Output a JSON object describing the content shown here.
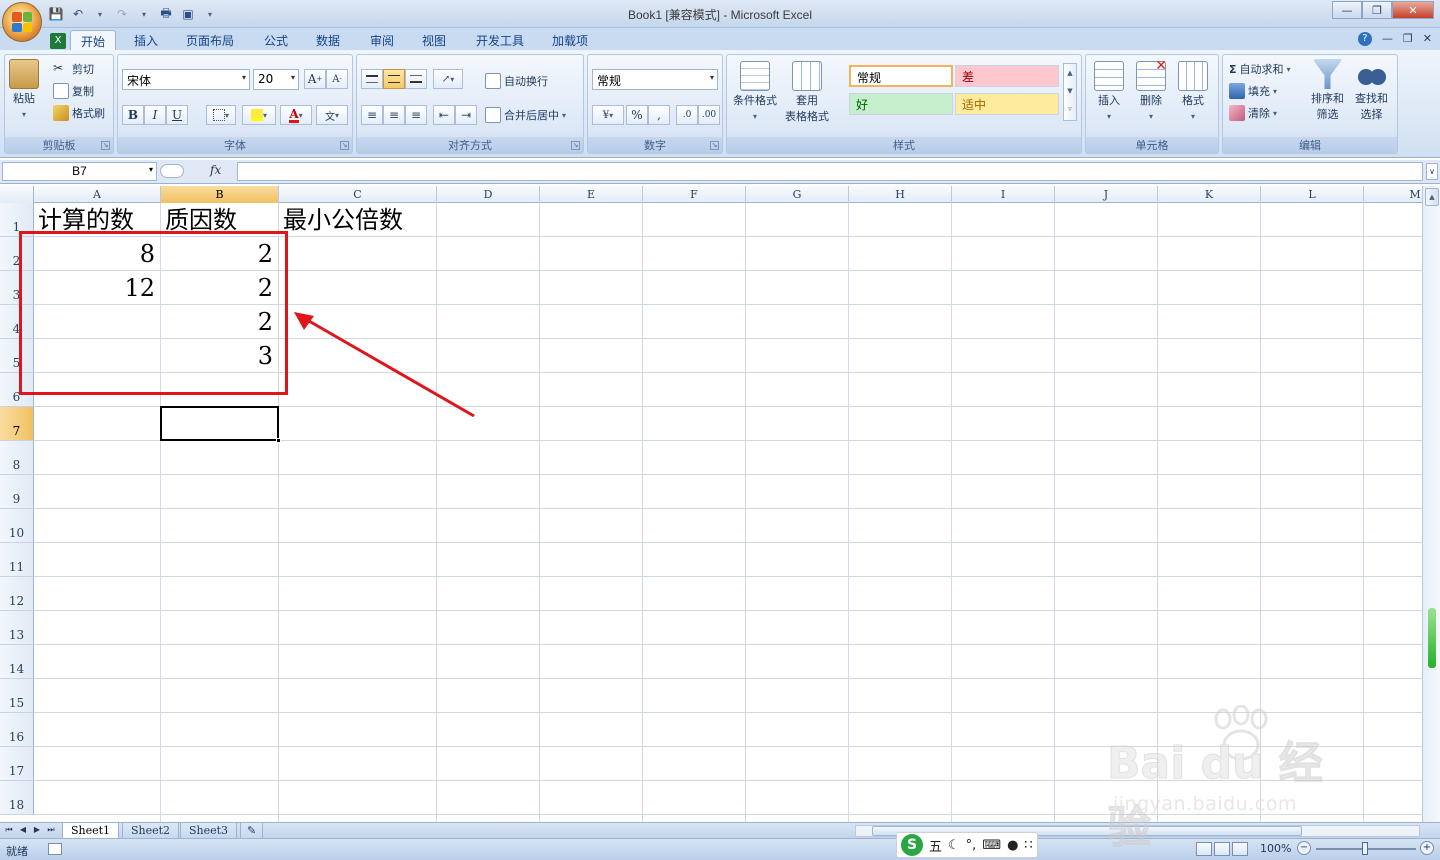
{
  "window": {
    "title": "Book1  [兼容模式] - Microsoft Excel"
  },
  "ribbon_tabs": [
    {
      "label": "开始",
      "active": true
    },
    {
      "label": "插入"
    },
    {
      "label": "页面布局"
    },
    {
      "label": "公式"
    },
    {
      "label": "数据"
    },
    {
      "label": "审阅"
    },
    {
      "label": "视图"
    },
    {
      "label": "开发工具"
    },
    {
      "label": "加载项"
    }
  ],
  "clipboard": {
    "group_label": "剪贴板",
    "paste": "粘贴",
    "cut": "剪切",
    "copy": "复制",
    "format_painter": "格式刷"
  },
  "font": {
    "group_label": "字体",
    "font_name": "宋体",
    "font_size": "20",
    "bold": "B",
    "italic": "I",
    "underline": "U"
  },
  "alignment": {
    "group_label": "对齐方式",
    "wrap_text": "自动换行",
    "merge_center": "合并后居中"
  },
  "number": {
    "group_label": "数字",
    "format": "常规",
    "percent": "%",
    "comma": ","
  },
  "styles": {
    "group_label": "样式",
    "conditional_format": "条件格式",
    "table_format_line1": "套用",
    "table_format_line2": "表格格式",
    "cells": [
      {
        "label": "常规",
        "bg": "#ffffff",
        "color": "#000000"
      },
      {
        "label": "差",
        "bg": "#ffc7ce",
        "color": "#9c0006"
      },
      {
        "label": "好",
        "bg": "#c6efce",
        "color": "#006100"
      },
      {
        "label": "适中",
        "bg": "#ffeb9c",
        "color": "#9c6500"
      }
    ]
  },
  "cells_group": {
    "group_label": "单元格",
    "insert": "插入",
    "delete": "删除",
    "format": "格式"
  },
  "editing": {
    "group_label": "编辑",
    "autosum": "自动求和",
    "fill": "填充",
    "clear": "清除",
    "sort_filter_line1": "排序和",
    "sort_filter_line2": "筛选",
    "find_select_line1": "查找和",
    "find_select_line2": "选择"
  },
  "formula_bar": {
    "name_box": "B7",
    "fx": "fx",
    "formula": ""
  },
  "columns": [
    "A",
    "B",
    "C",
    "D",
    "E",
    "F",
    "G",
    "H",
    "I",
    "J",
    "K",
    "L",
    "M"
  ],
  "rows": [
    "1",
    "2",
    "3",
    "4",
    "5",
    "6",
    "7",
    "8",
    "9",
    "10",
    "11",
    "12",
    "13",
    "14",
    "15",
    "16",
    "17",
    "18"
  ],
  "selected": {
    "column": "B",
    "row": "7"
  },
  "cells": {
    "A1": "计算的数",
    "B1": "质因数",
    "C1": "最小公倍数",
    "A2": "8",
    "B2": "2",
    "A3": "12",
    "B3": "2",
    "B4": "2",
    "B5": "3"
  },
  "sheets": [
    {
      "label": "Sheet1",
      "active": true
    },
    {
      "label": "Sheet2"
    },
    {
      "label": "Sheet3"
    }
  ],
  "status": {
    "ready": "就绪",
    "zoom": "100%",
    "ime_mode": "五"
  },
  "annotation_color": "#e0141b",
  "watermark": {
    "brand": "Bai du 经验",
    "url": "jingyan.baidu.com"
  }
}
